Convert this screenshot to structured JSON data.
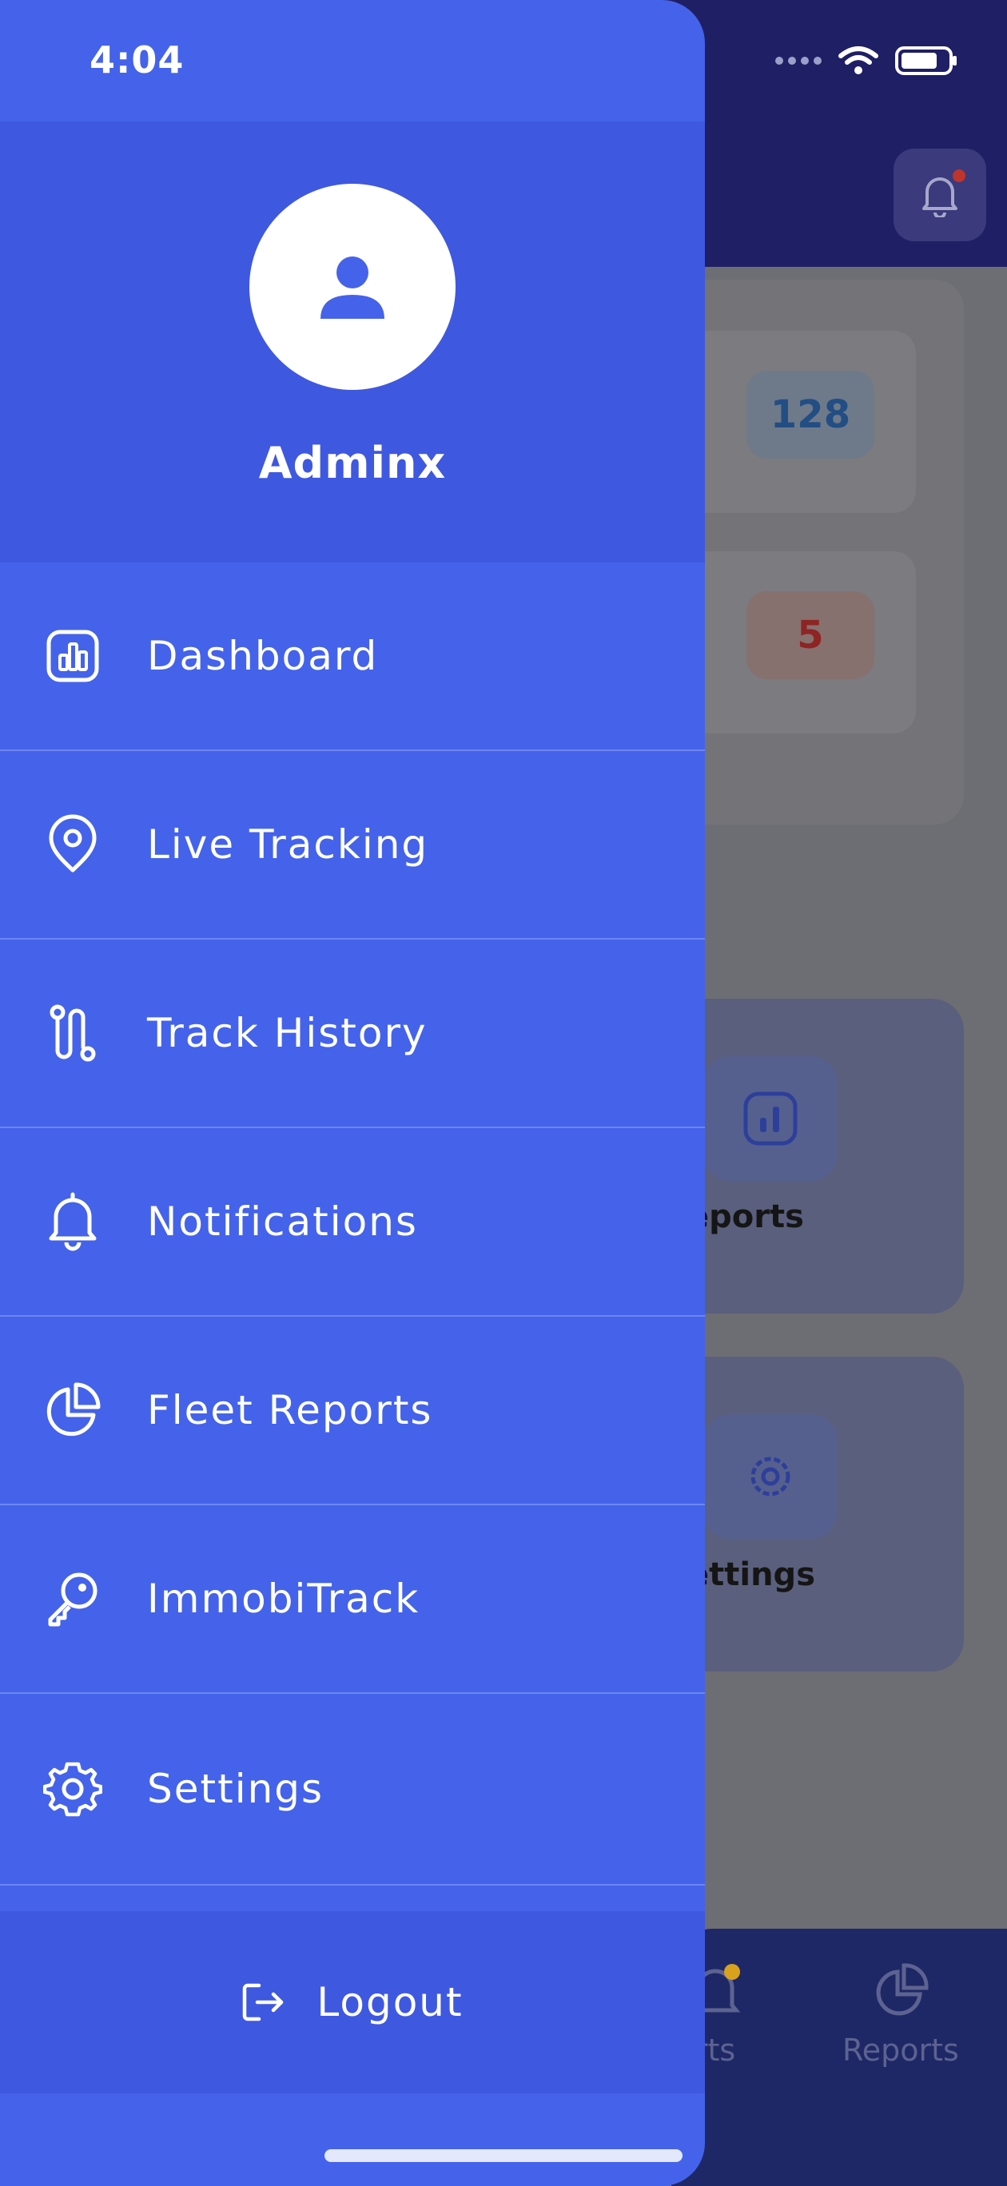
{
  "status_bar": {
    "time": "4:04"
  },
  "background": {
    "stats": [
      {
        "value": "128"
      },
      {
        "value": "5"
      }
    ],
    "tiles": [
      {
        "label": "eports"
      },
      {
        "label": "ettings"
      }
    ],
    "tabbar": [
      {
        "label": "rts"
      },
      {
        "label": "Reports"
      }
    ]
  },
  "drawer": {
    "user_name": "Adminx",
    "menu": [
      {
        "label": "Dashboard",
        "icon": "dashboard-icon"
      },
      {
        "label": "Live Tracking",
        "icon": "location-pin-icon"
      },
      {
        "label": "Track History",
        "icon": "route-icon"
      },
      {
        "label": "Notifications",
        "icon": "bell-icon"
      },
      {
        "label": "Fleet Reports",
        "icon": "pie-chart-icon"
      },
      {
        "label": "ImmobiTrack",
        "icon": "key-icon"
      },
      {
        "label": "Settings",
        "icon": "gear-icon"
      }
    ],
    "logout_label": "Logout"
  },
  "colors": {
    "drawer": "#4463ea",
    "profile": "#3f58e0",
    "header_bg": "#1f1f66"
  }
}
